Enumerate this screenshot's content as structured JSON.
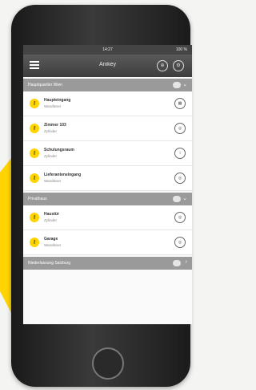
{
  "status": {
    "time": "14:27",
    "battery": "100 %"
  },
  "header": {
    "title": "Anikey"
  },
  "sections": [
    {
      "label": "Hauptquartier Wien",
      "items": [
        {
          "name": "Haupteingang",
          "sub": "Wandleser"
        },
        {
          "name": "Zimmer 103",
          "sub": "Zylinder"
        },
        {
          "name": "Schulungsraum",
          "sub": "Zylinder"
        },
        {
          "name": "Lieferanteneingang",
          "sub": "Wandleser"
        }
      ]
    },
    {
      "label": "Privathaus",
      "items": [
        {
          "name": "Haustür",
          "sub": "Zylinder"
        },
        {
          "name": "Garage",
          "sub": "Wandleser"
        }
      ]
    },
    {
      "label": "Niederlassung Salzburg",
      "items": []
    }
  ]
}
